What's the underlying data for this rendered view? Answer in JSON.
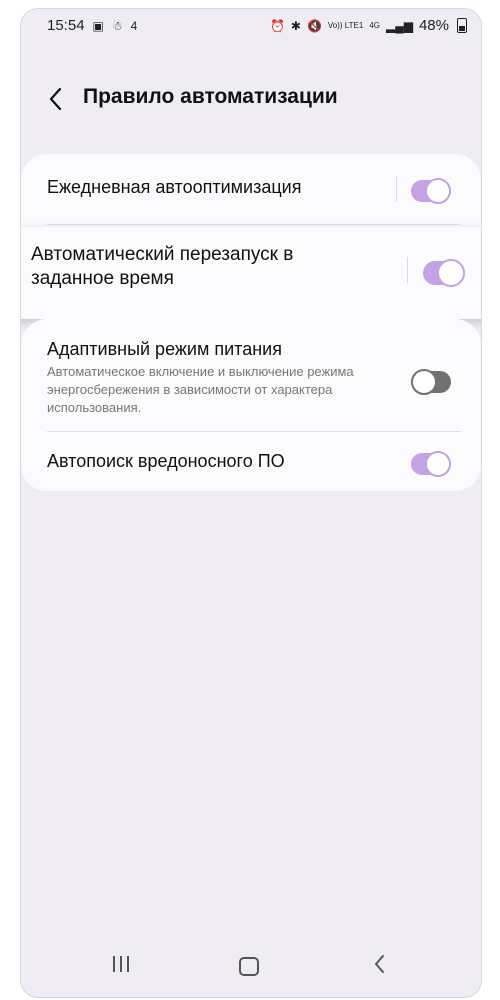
{
  "status": {
    "time": "15:54",
    "signal_small": "4",
    "network_volte": "Vo)) LTE1",
    "network_type": "4G",
    "battery": "48%"
  },
  "header": {
    "title": "Правило автоматизации"
  },
  "settings": [
    {
      "title": "Ежедневная автооптимизация",
      "enabled": true
    },
    {
      "title": "Автоматический перезапуск в заданное время",
      "enabled": true
    },
    {
      "title": "Адаптивный режим питания",
      "description": "Автоматическое включение и выключение режима энергосбережения в зависимости от характера использования.",
      "enabled": false
    },
    {
      "title": "Автопоиск вредоносного ПО",
      "enabled": true
    }
  ],
  "colors": {
    "toggle_on": "#c3a3e2",
    "toggle_off": "#717171",
    "background": "#efedf3"
  },
  "icons": [
    "gallery-icon",
    "android-icon",
    "alarm-icon",
    "bluetooth-icon",
    "mute-icon",
    "signal-icon",
    "battery-icon",
    "back-arrow-icon",
    "nav-recents-icon",
    "nav-home-icon",
    "nav-back-icon"
  ]
}
